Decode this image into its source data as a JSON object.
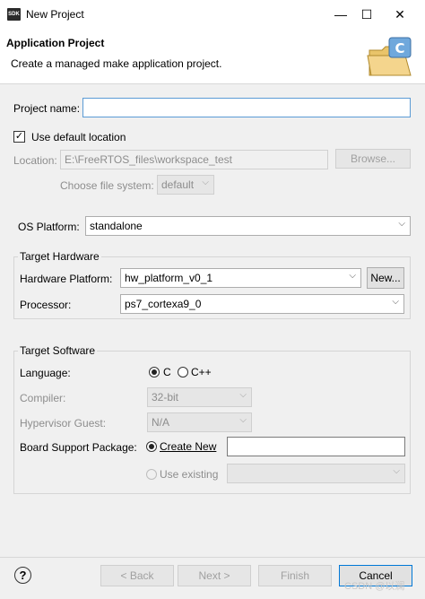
{
  "window": {
    "app_icon_text": "SDK",
    "title": "New Project",
    "controls": {
      "minimize": "—",
      "maximize": "☐",
      "close": "✕"
    }
  },
  "header": {
    "title": "Application Project",
    "description": "Create a managed make application project.",
    "icon": "new-project-folder-c-icon"
  },
  "form": {
    "project_name": {
      "label": "Project name:",
      "value": ""
    },
    "use_default_location": {
      "label": "Use default location",
      "checked": true
    },
    "location": {
      "label": "Location:",
      "value": "E:\\FreeRTOS_files\\workspace_test",
      "browse": "Browse..."
    },
    "file_system": {
      "label": "Choose file system:",
      "value": "default"
    },
    "os_platform": {
      "label": "OS Platform:",
      "value": "standalone"
    }
  },
  "target_hardware": {
    "title": "Target Hardware",
    "platform_label": "Hardware Platform:",
    "platform_value": "hw_platform_v0_1",
    "new_button": "New...",
    "processor_label": "Processor:",
    "processor_value": "ps7_cortexa9_0"
  },
  "target_software": {
    "title": "Target Software",
    "language_label": "Language:",
    "language_options": [
      "C",
      "C++"
    ],
    "language_selected": "C",
    "compiler_label": "Compiler:",
    "compiler_value": "32-bit",
    "hypervisor_label": "Hypervisor Guest:",
    "hypervisor_value": "N/A",
    "bsp_label": "Board Support Package:",
    "bsp_create_label": "Create New",
    "bsp_create_value": "",
    "bsp_existing_label": "Use existing",
    "bsp_existing_value": ""
  },
  "footer": {
    "help": "?",
    "back": "< Back",
    "next": "Next >",
    "finish": "Finish",
    "cancel": "Cancel"
  },
  "watermark": "CSDN @以澜"
}
